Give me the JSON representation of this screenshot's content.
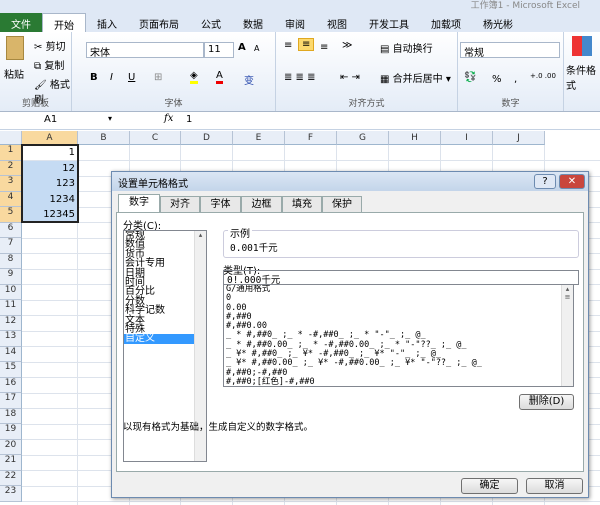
{
  "window": {
    "title": "工作簿1 - Microsoft Excel"
  },
  "tabs": [
    "文件",
    "开始",
    "插入",
    "页面布局",
    "公式",
    "数据",
    "审阅",
    "视图",
    "开发工具",
    "加载项",
    "杨光彬"
  ],
  "ribbon": {
    "clipboard": {
      "paste": "粘贴",
      "cut": "剪切",
      "copy": "复制",
      "format_painter": "格式刷",
      "label": "剪贴板"
    },
    "font": {
      "name": "宋体",
      "size": "11",
      "bold": "B",
      "italic": "I",
      "underline": "U",
      "font_color": "A",
      "grow": "A",
      "shrink": "A",
      "phonetic": "变",
      "label": "字体"
    },
    "alignment": {
      "wrap": "自动换行",
      "merge": "合并后居中",
      "label": "对齐方式"
    },
    "number": {
      "format": "常规",
      "percent": "%",
      "comma": ",",
      "label": "数字"
    },
    "styles": {
      "conditional": "条件格式"
    }
  },
  "formula_bar": {
    "name_box": "A1",
    "fx": "fx",
    "value": "1"
  },
  "grid": {
    "columns": [
      "A",
      "B",
      "C",
      "D",
      "E",
      "F",
      "G",
      "H",
      "I",
      "J"
    ],
    "rows": [
      "1",
      "2",
      "3",
      "4",
      "5",
      "6",
      "7",
      "8",
      "9",
      "10",
      "11",
      "12",
      "13",
      "14",
      "15",
      "16",
      "17",
      "18",
      "19",
      "20",
      "21",
      "22",
      "23"
    ],
    "cells_A": [
      "1",
      "12",
      "123",
      "1234",
      "12345"
    ]
  },
  "dialog": {
    "title": "设置单元格格式",
    "help": "?",
    "close": "✕",
    "tabs": [
      "数字",
      "对齐",
      "字体",
      "边框",
      "填充",
      "保护"
    ],
    "category_label": "分类(C):",
    "categories": [
      "常规",
      "数值",
      "货币",
      "会计专用",
      "日期",
      "时间",
      "百分比",
      "分数",
      "科学记数",
      "文本",
      "特殊",
      "自定义"
    ],
    "selected_category": "自定义",
    "sample_label": "示例",
    "sample_value": "0.001千元",
    "type_label": "类型(T):",
    "type_value": "0!.000千元",
    "formats": [
      "G/通用格式",
      "0",
      "0.00",
      "#,##0",
      "#,##0.00",
      "_ * #,##0_ ;_ * -#,##0_ ;_ * \"-\"_ ;_ @_",
      "_ * #,##0.00_ ;_ * -#,##0.00_ ;_ * \"-\"??_ ;_ @_",
      "_ ¥* #,##0_ ;_ ¥* -#,##0_ ;_ ¥* \"-\"_ ;_ @_",
      "_ ¥* #,##0.00_ ;_ ¥* -#,##0.00_ ;_ ¥* \"-\"??_ ;_ @_",
      "#,##0;-#,##0",
      "#,##0;[红色]-#,##0"
    ],
    "delete": "删除(D)",
    "hint": "以现有格式为基础，生成自定义的数字格式。",
    "ok": "确定",
    "cancel": "取消"
  }
}
